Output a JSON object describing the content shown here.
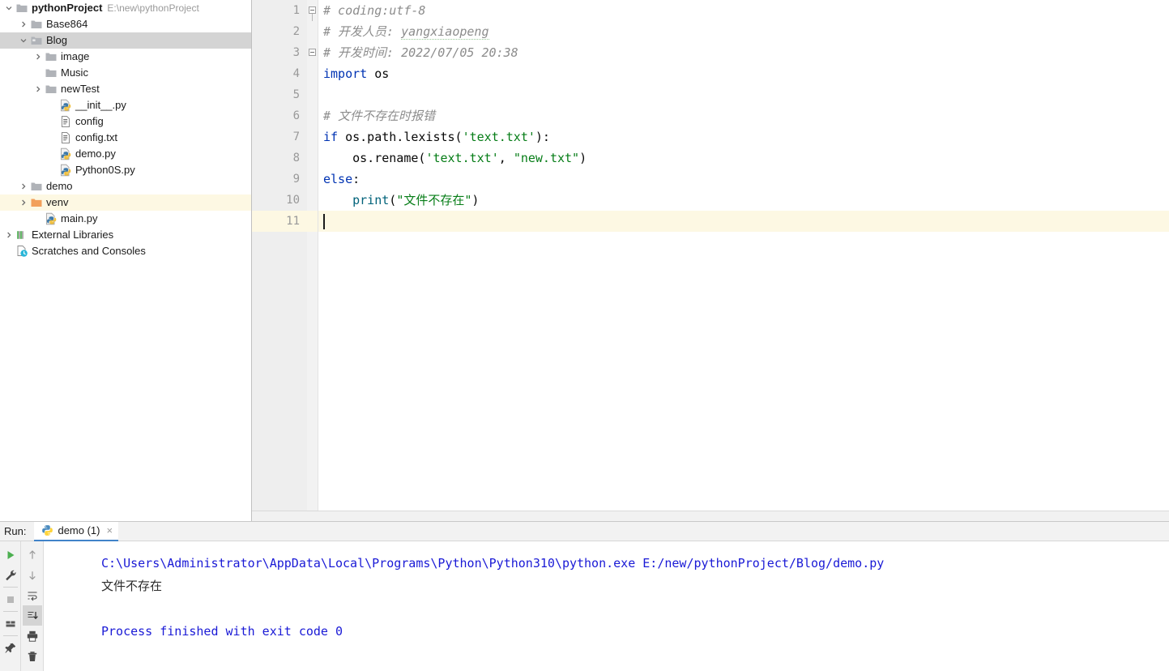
{
  "project": {
    "root": {
      "label": "pythonProject",
      "path": "E:\\new\\pythonProject",
      "icon": "folder-icon"
    },
    "items": [
      {
        "label": "Base864",
        "icon": "folder-icon",
        "indent": 1,
        "twisty": "chevron-right",
        "state": "normal"
      },
      {
        "label": "Blog",
        "icon": "folder-open-icon",
        "indent": 1,
        "twisty": "chevron-down",
        "state": "selected"
      },
      {
        "label": "image",
        "icon": "folder-icon",
        "indent": 2,
        "twisty": "chevron-right",
        "state": "normal"
      },
      {
        "label": "Music",
        "icon": "folder-icon",
        "indent": 2,
        "twisty": "none",
        "state": "normal"
      },
      {
        "label": "newTest",
        "icon": "folder-icon",
        "indent": 2,
        "twisty": "chevron-right",
        "state": "normal"
      },
      {
        "label": "__init__.py",
        "icon": "python-file-icon",
        "indent": 3,
        "twisty": "none",
        "state": "normal"
      },
      {
        "label": "config",
        "icon": "text-file-icon",
        "indent": 3,
        "twisty": "none",
        "state": "normal"
      },
      {
        "label": "config.txt",
        "icon": "text-file-icon",
        "indent": 3,
        "twisty": "none",
        "state": "normal"
      },
      {
        "label": "demo.py",
        "icon": "python-file-icon",
        "indent": 3,
        "twisty": "none",
        "state": "normal"
      },
      {
        "label": "Python0S.py",
        "icon": "python-file-icon",
        "indent": 3,
        "twisty": "none",
        "state": "normal"
      },
      {
        "label": "demo",
        "icon": "folder-icon",
        "indent": 1,
        "twisty": "chevron-right",
        "state": "normal"
      },
      {
        "label": "venv",
        "icon": "folder-orange-icon",
        "indent": 1,
        "twisty": "chevron-right",
        "state": "marked"
      },
      {
        "label": "main.py",
        "icon": "python-file-icon",
        "indent": 2,
        "twisty": "none",
        "state": "normal"
      },
      {
        "label": "External Libraries",
        "icon": "libraries-icon",
        "indent": 0,
        "twisty": "chevron-right",
        "state": "normal"
      },
      {
        "label": "Scratches and Consoles",
        "icon": "scratches-icon",
        "indent": 0,
        "twisty": "none",
        "state": "normal"
      }
    ]
  },
  "editor": {
    "active_tab_accent": "#4083c9",
    "current_line": 11,
    "line_numbers": [
      "1",
      "2",
      "3",
      "4",
      "5",
      "6",
      "7",
      "8",
      "9",
      "10",
      "11"
    ],
    "lines": [
      {
        "n": 1,
        "tokens": [
          {
            "t": "# coding:utf-8",
            "c": "cmt"
          }
        ]
      },
      {
        "n": 2,
        "tokens": [
          {
            "t": "# 开发人员: ",
            "c": "cmt"
          },
          {
            "t": "yangxiaopeng",
            "c": "cmt-spell"
          }
        ]
      },
      {
        "n": 3,
        "tokens": [
          {
            "t": "# 开发时间: 2022/07/05 20:38",
            "c": "cmt"
          }
        ]
      },
      {
        "n": 4,
        "tokens": [
          {
            "t": "import",
            "c": "kw"
          },
          {
            "t": " os",
            "c": "plain"
          }
        ]
      },
      {
        "n": 5,
        "tokens": []
      },
      {
        "n": 6,
        "tokens": [
          {
            "t": "# 文件不存在时报错",
            "c": "cmt"
          }
        ]
      },
      {
        "n": 7,
        "tokens": [
          {
            "t": "if",
            "c": "kw"
          },
          {
            "t": " os.path.lexists(",
            "c": "plain"
          },
          {
            "t": "'text.txt'",
            "c": "str"
          },
          {
            "t": "):",
            "c": "plain"
          }
        ]
      },
      {
        "n": 8,
        "tokens": [
          {
            "t": "    os.rename(",
            "c": "plain"
          },
          {
            "t": "'text.txt'",
            "c": "str"
          },
          {
            "t": ", ",
            "c": "plain"
          },
          {
            "t": "\"new.txt\"",
            "c": "str"
          },
          {
            "t": ")",
            "c": "plain"
          }
        ]
      },
      {
        "n": 9,
        "tokens": [
          {
            "t": "else",
            "c": "kw"
          },
          {
            "t": ":",
            "c": "plain"
          }
        ]
      },
      {
        "n": 10,
        "tokens": [
          {
            "t": "    ",
            "c": "plain"
          },
          {
            "t": "print",
            "c": "fn"
          },
          {
            "t": "(",
            "c": "plain"
          },
          {
            "t": "\"文件不存在\"",
            "c": "str"
          },
          {
            "t": ")",
            "c": "plain"
          }
        ]
      },
      {
        "n": 11,
        "tokens": []
      }
    ]
  },
  "run": {
    "label": "Run:",
    "tab": {
      "title": "demo (1)",
      "icon": "python-file-icon",
      "close": "×"
    },
    "toolbar_left": [
      {
        "name": "rerun-button",
        "icon": "play-icon"
      },
      {
        "name": "debug-settings-button",
        "icon": "wrench-icon"
      },
      {
        "name": "stop-button",
        "icon": "stop-icon"
      },
      {
        "name": "layout-button",
        "icon": "layout-icon"
      },
      {
        "name": "pin-tab-button",
        "icon": "pin-icon"
      }
    ],
    "toolbar_right": [
      {
        "name": "up-stack-button",
        "icon": "arrow-up-icon",
        "active": false
      },
      {
        "name": "down-stack-button",
        "icon": "arrow-down-icon",
        "active": false
      },
      {
        "name": "soft-wrap-button",
        "icon": "wrap-icon",
        "active": false
      },
      {
        "name": "scroll-to-end-button",
        "icon": "scroll-end-icon",
        "active": true
      },
      {
        "name": "print-button",
        "icon": "printer-icon",
        "active": false
      },
      {
        "name": "clear-all-button",
        "icon": "trash-icon",
        "active": false
      }
    ],
    "console": [
      {
        "text": "C:\\Users\\Administrator\\AppData\\Local\\Programs\\Python\\Python310\\python.exe E:/new/pythonProject/Blog/demo.py",
        "color": "blue"
      },
      {
        "text": "文件不存在",
        "color": "dark"
      },
      {
        "text": "",
        "color": "dark"
      },
      {
        "text": "Process finished with exit code 0",
        "color": "blue"
      }
    ]
  },
  "colors": {
    "accent": "#4083c9",
    "keyword": "#0033b3",
    "string": "#067d17",
    "comment": "#8c8c8c",
    "console_blue": "#1a1ad6",
    "selection": "#d4d4d4",
    "marked_row": "#fdf8e3"
  }
}
